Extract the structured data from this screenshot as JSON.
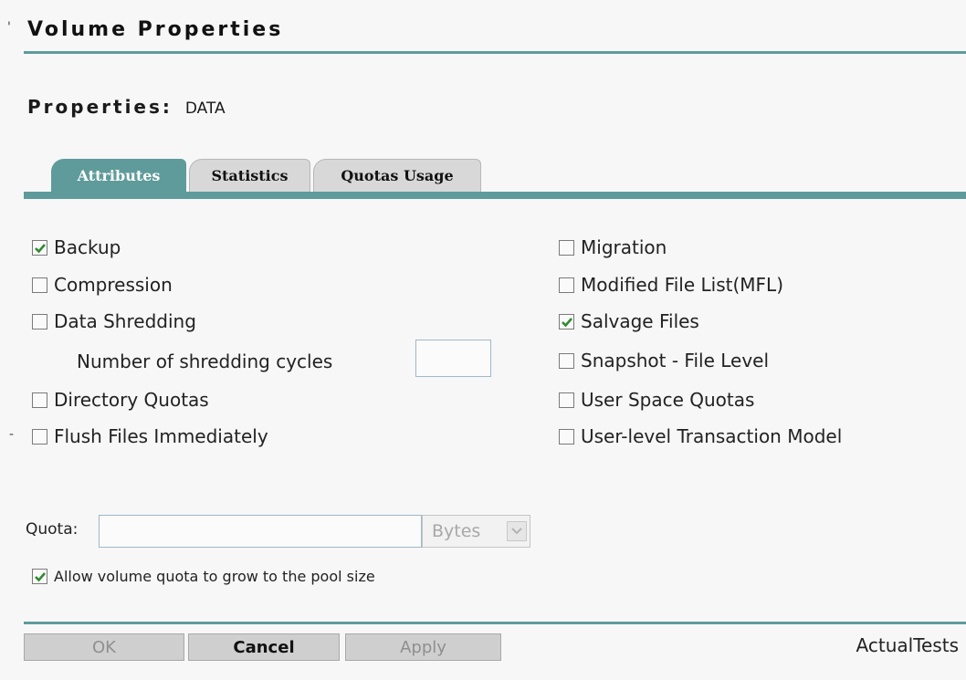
{
  "page": {
    "title": "Volume Properties",
    "heading_label": "Properties",
    "heading_separator": ":",
    "heading_value": "DATA"
  },
  "tabs": [
    {
      "label": "Attributes",
      "active": true
    },
    {
      "label": "Statistics",
      "active": false
    },
    {
      "label": "Quotas Usage",
      "active": false
    }
  ],
  "attributes_left": [
    {
      "label": "Backup",
      "checked": true
    },
    {
      "label": "Compression",
      "checked": false
    },
    {
      "label": "Data Shredding",
      "checked": false
    },
    {
      "label": "Directory Quotas",
      "checked": false
    },
    {
      "label": "Flush Files Immediately",
      "checked": false
    }
  ],
  "shredding": {
    "label": "Number of shredding cycles",
    "value": ""
  },
  "attributes_right": [
    {
      "label": "Migration",
      "checked": false
    },
    {
      "label": "Modified File List(MFL)",
      "checked": false
    },
    {
      "label": "Salvage Files",
      "checked": true
    },
    {
      "label": "Snapshot - File Level",
      "checked": false
    },
    {
      "label": "User Space Quotas",
      "checked": false
    },
    {
      "label": "User-level Transaction Model",
      "checked": false
    }
  ],
  "quota": {
    "label": "Quota:",
    "value": "",
    "unit": "Bytes",
    "grow_label": "Allow volume quota to grow to the pool size",
    "grow_checked": true
  },
  "buttons": {
    "ok": "OK",
    "cancel": "Cancel",
    "apply": "Apply"
  },
  "watermark": "ActualTests",
  "colors": {
    "accent": "#5f9b9b",
    "check": "#2f8a2f"
  }
}
